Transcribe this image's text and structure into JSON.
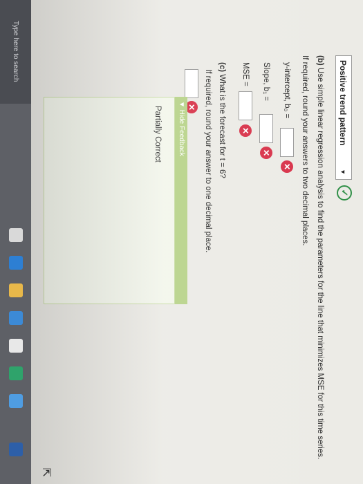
{
  "header": {
    "dropdown_label": "Positive trend pattern",
    "caret": "▼",
    "check": "✓"
  },
  "part_b": {
    "heading_bold": "(b)",
    "heading": "Use simple linear regression analysis to find the parameters for the line that minimizes MSE for this time series.",
    "instruction": "If required, round your answers to two decimal places.",
    "y_intercept_label": "y-intercept, b₀ =",
    "slope_label": "Slope, b₁ =",
    "mse_label": "MSE ="
  },
  "part_c": {
    "heading_bold": "(c)",
    "heading": "What is the forecast for t = 6?",
    "instruction": "If required, round your answer to one decimal place."
  },
  "feedback": {
    "toggle_label": "▼ Hide Feedback",
    "status": "Partially Correct"
  },
  "taskbar": {
    "search_placeholder": "Type here to search"
  },
  "icons": {
    "wrong": "✕",
    "cursor": "⇱"
  },
  "colors": {
    "correct_green": "#2f8f46",
    "wrong_red": "#d8334a",
    "feedback_green": "#b8d38a"
  }
}
